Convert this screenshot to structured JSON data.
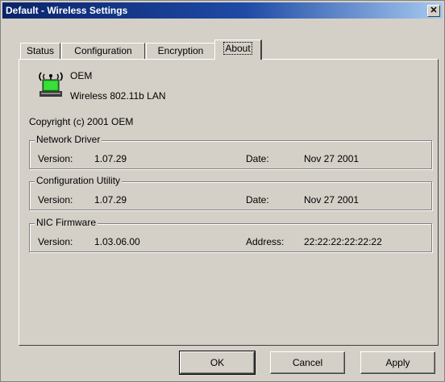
{
  "window": {
    "title": "Default - Wireless Settings",
    "close_glyph": "✕"
  },
  "tabs": [
    {
      "label": "Status",
      "active": false
    },
    {
      "label": "Configuration",
      "active": false
    },
    {
      "label": "Encryption",
      "active": false
    },
    {
      "label": "About",
      "active": true
    }
  ],
  "about": {
    "icon": "wireless-nic-icon",
    "vendor": "OEM",
    "product": "Wireless 802.11b LAN",
    "copyright": "Copyright (c) 2001  OEM"
  },
  "groups": {
    "driver": {
      "title": "Network Driver",
      "version_label": "Version:",
      "version": "1.07.29",
      "date_label": "Date:",
      "date": "Nov 27 2001"
    },
    "utility": {
      "title": "Configuration Utility",
      "version_label": "Version:",
      "version": "1.07.29",
      "date_label": "Date:",
      "date": "Nov 27 2001"
    },
    "firmware": {
      "title": "NIC Firmware",
      "version_label": "Version:",
      "version": "1.03.06.00",
      "address_label": "Address:",
      "address": "22:22:22:22:22:22"
    }
  },
  "buttons": {
    "ok": "OK",
    "cancel": "Cancel",
    "apply": "Apply"
  }
}
